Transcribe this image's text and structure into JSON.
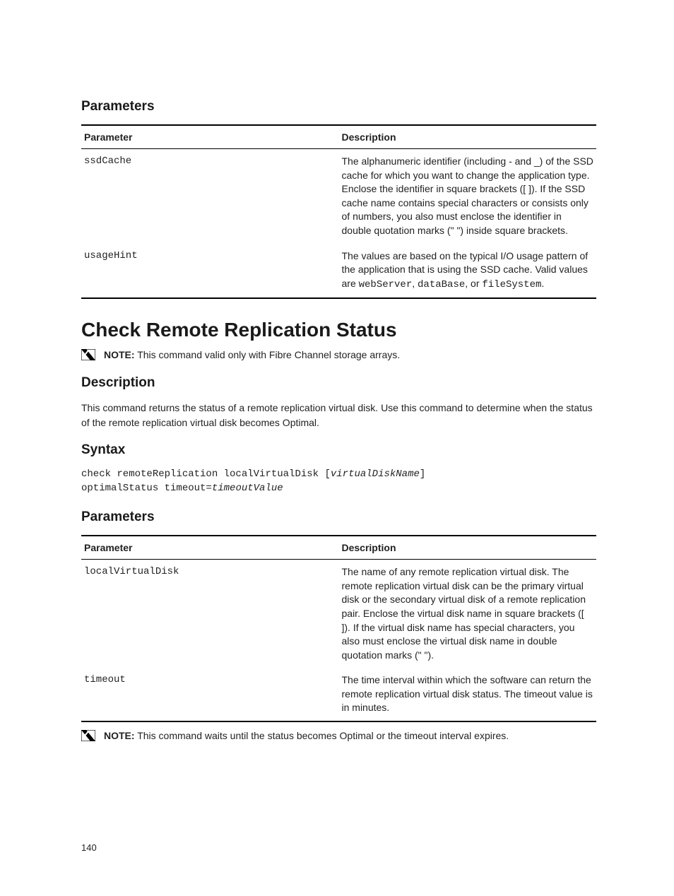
{
  "section1": {
    "heading": "Parameters",
    "table": {
      "head_param": "Parameter",
      "head_desc": "Description",
      "rows": [
        {
          "param": "ssdCache",
          "desc": "The alphanumeric identifier (including - and _) of the SSD cache for which you want to change the application type. Enclose the identifier in square brackets ([ ]). If the SSD cache name contains special characters or consists only of numbers, you also must enclose the identifier in double quotation marks (\" \") inside square brackets."
        },
        {
          "param": "usageHint",
          "desc_pre": "The values are based on the typical I/O usage pattern of the application that is using the SSD cache. Valid values are ",
          "code1": "webServer",
          "sep1": ", ",
          "code2": "dataBase",
          "sep2": ", or ",
          "code3": "fileSystem",
          "desc_post": "."
        }
      ]
    }
  },
  "topic": {
    "title": "Check Remote Replication Status",
    "note1": {
      "label": "NOTE:",
      "text": " This command valid only with Fibre Channel storage arrays."
    },
    "description_h": "Description",
    "description_p": "This command returns the status of a remote replication virtual disk. Use this command to determine when the status of the remote replication virtual disk becomes Optimal.",
    "syntax_h": "Syntax",
    "syntax_line1_pre": "check remoteReplication localVirtualDisk [",
    "syntax_line1_var": "virtualDiskName",
    "syntax_line1_post": "]",
    "syntax_line2_pre": "optimalStatus timeout=",
    "syntax_line2_var": "timeoutValue",
    "params_h": "Parameters",
    "table": {
      "head_param": "Parameter",
      "head_desc": "Description",
      "rows": [
        {
          "param": "localVirtualDisk",
          "desc": "The name of any remote replication virtual disk. The remote replication virtual disk can be the primary virtual disk or the secondary virtual disk of a remote replication pair. Enclose the virtual disk name in square brackets ([ ]). If the virtual disk name has special characters, you also must enclose the virtual disk name in double quotation marks (\" \")."
        },
        {
          "param": "timeout",
          "desc": "The time interval within which the software can return the remote replication virtual disk status. The timeout value is in minutes."
        }
      ]
    },
    "note2": {
      "label": "NOTE:",
      "text": " This command waits until the status becomes Optimal or the timeout interval expires."
    }
  },
  "page_number": "140"
}
